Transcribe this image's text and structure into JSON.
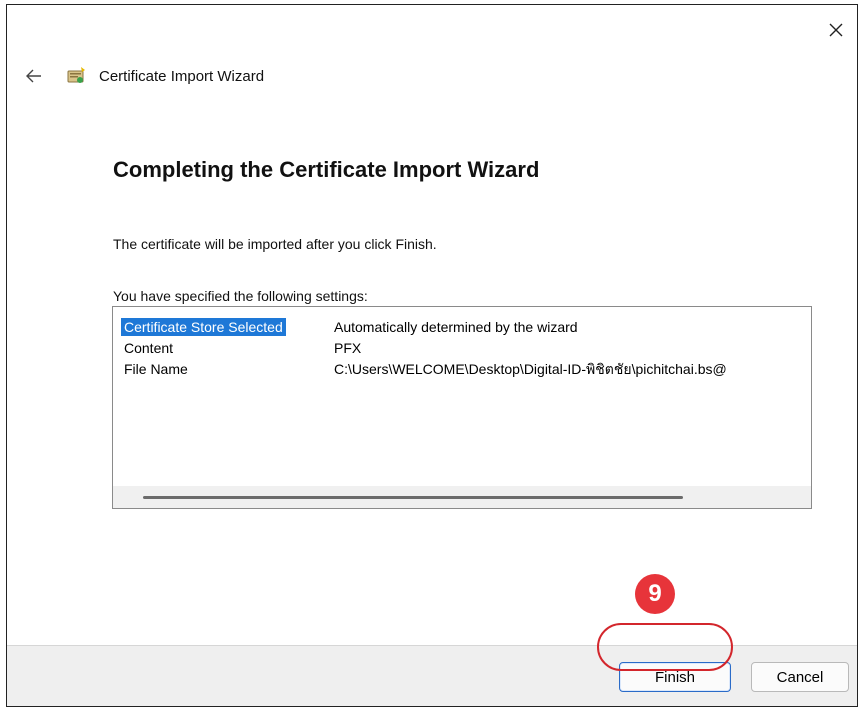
{
  "window": {
    "title": "Certificate Import Wizard",
    "close_icon": "close-icon",
    "back_icon": "back-arrow-icon",
    "app_icon": "certificate-wizard-icon"
  },
  "main": {
    "heading": "Completing the Certificate Import Wizard",
    "info": "The certificate will be imported after you click Finish.",
    "settings_label": "You have specified the following settings:",
    "settings": [
      {
        "key": "Certificate Store Selected",
        "value": "Automatically determined by the wizard",
        "selected": true
      },
      {
        "key": "Content",
        "value": "PFX",
        "selected": false
      },
      {
        "key": "File Name",
        "value": "C:\\Users\\WELCOME\\Desktop\\Digital-ID-พิชิตชัย\\pichitchai.bs@",
        "selected": false
      }
    ]
  },
  "footer": {
    "finish_label": "Finish",
    "cancel_label": "Cancel"
  },
  "annotation": {
    "step_number": "9",
    "color": "#e7343a"
  },
  "colors": {
    "selection": "#1e78d7",
    "default_button_border": "#2a6bc8"
  }
}
